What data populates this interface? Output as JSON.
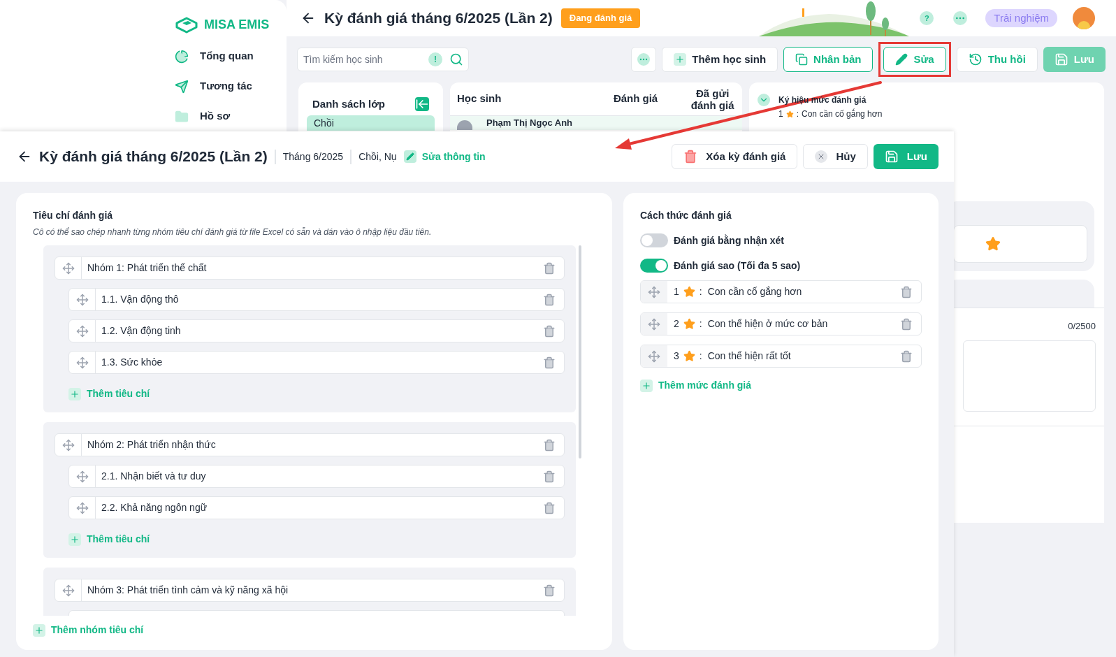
{
  "sidebar": {
    "brand": "MISA EMIS",
    "items": [
      {
        "label": "Tổng quan",
        "kind": "overview"
      },
      {
        "label": "Tương tác",
        "kind": "interact"
      },
      {
        "label": "Hồ sơ",
        "kind": "records"
      }
    ]
  },
  "page": {
    "title": "Kỳ đánh giá tháng 6/2025 (Lần 2)",
    "status": "Đang đánh giá",
    "help": "?",
    "trial": "Trải nghiệm",
    "search_placeholder": "Tìm kiếm học sinh",
    "search_info": "!",
    "actions": [
      {
        "label": "Thêm học sinh",
        "kind": "add",
        "highlighted": false
      },
      {
        "label": "Nhân bản",
        "kind": "copy",
        "highlighted": false
      },
      {
        "label": "Sửa",
        "kind": "edit",
        "highlighted": true
      },
      {
        "label": "Thu hồi",
        "kind": "recall",
        "highlighted": false
      },
      {
        "label": "Lưu",
        "kind": "save",
        "highlighted": false
      }
    ],
    "class_list": {
      "title": "Danh sách lớp",
      "items": [
        {
          "label": "Chồi",
          "selected": true
        }
      ]
    },
    "students": {
      "columns": [
        "Học sinh",
        "Đánh giá",
        "Đã gửi đánh giá"
      ],
      "rows": [
        {
          "name": "Phạm Thị Ngọc Anh"
        }
      ]
    },
    "legend": {
      "title": "Ký hiệu mức đánh giá",
      "items": [
        {
          "number": "1",
          "separator": ":",
          "text": "Con cần cố gắng hơn"
        }
      ]
    },
    "comment_counter": "0/2500"
  },
  "editor": {
    "title": "Kỳ đánh giá tháng 6/2025 (Lần 2)",
    "period": "Tháng 6/2025",
    "classes": "Chồi, Nụ",
    "edit_info": "Sửa thông tin",
    "delete": "Xóa kỳ đánh giá",
    "cancel": "Hủy",
    "save": "Lưu",
    "criteria": {
      "title": "Tiêu chí đánh giá",
      "hint": "Cô có thể sao chép nhanh từng nhóm tiêu chí đánh giá từ file Excel có sẵn và dán vào ô nhập liệu đầu tiên.",
      "groups": [
        {
          "name": "Nhóm 1: Phát triển thể chất",
          "items": [
            "1.1. Vận động thô",
            "1.2. Vận động tinh",
            "1.3. Sức khỏe"
          ],
          "add_label": "Thêm tiêu chí"
        },
        {
          "name": "Nhóm 2: Phát triển nhận thức",
          "items": [
            "2.1. Nhận biết và tư duy",
            "2.2. Khả năng ngôn ngữ"
          ],
          "add_label": "Thêm tiêu chí"
        },
        {
          "name": "Nhóm 3: Phát triển tình cảm và kỹ năng xã hội"
        }
      ],
      "add_group": "Thêm nhóm tiêu chí"
    },
    "method": {
      "title": "Cách thức đánh giá",
      "options": [
        {
          "label": "Đánh giá bằng nhận xét",
          "on": false
        },
        {
          "label": "Đánh giá sao (Tối đa 5 sao)",
          "on": true
        }
      ],
      "levels": [
        {
          "number": "1",
          "separator": ":",
          "text": "Con cần cố gắng hơn"
        },
        {
          "number": "2",
          "separator": ":",
          "text": "Con thể hiện ở mức cơ bản"
        },
        {
          "number": "3",
          "separator": ":",
          "text": "Con thể hiện rất tốt"
        }
      ],
      "add_level": "Thêm mức đánh giá"
    }
  }
}
